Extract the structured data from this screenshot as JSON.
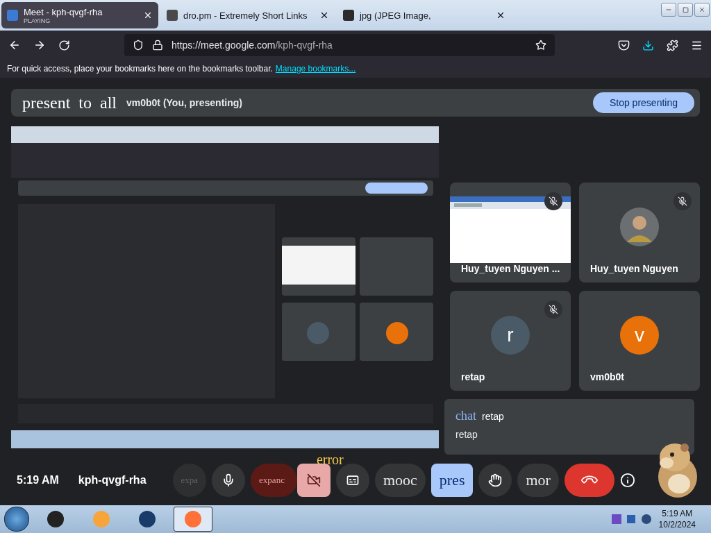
{
  "tabs": [
    {
      "title": "Meet - kph-qvgf-rha",
      "subtitle": "PLAYING",
      "selected": true
    },
    {
      "title": "dro.pm - Extremely Short Links",
      "selected": false
    },
    {
      "title": "jpg (JPEG Image, ",
      "selected": false
    }
  ],
  "address_bar": {
    "url_host": "https://meet.google.com",
    "url_path": "/kph-qvgf-rha"
  },
  "bookmarks_bar": {
    "message": "For quick access, place your bookmarks here on the bookmarks toolbar.",
    "link": "Manage bookmarks..."
  },
  "presenting_bar": {
    "title": "present to all",
    "presenter": "vm0b0t (You, presenting)",
    "button": "Stop presenting"
  },
  "participants": [
    {
      "name": "Huy_tuyen Nguyen ...",
      "kind": "screen",
      "muted": true
    },
    {
      "name": "Huy_tuyen Nguyen",
      "muted": true
    },
    {
      "name": "retap",
      "kind": "initial",
      "initial": "r",
      "color": "#4a5a66",
      "muted": true
    },
    {
      "name": "vm0b0t",
      "kind": "initial",
      "initial": "v",
      "color": "#e8710a",
      "muted": false
    }
  ],
  "chat": {
    "label": "chat",
    "sender": "retap",
    "message": "retap"
  },
  "meeting_info": {
    "time": "5:19 AM",
    "code": "kph-qvgf-rha"
  },
  "controls": [
    {
      "kind": "ghost",
      "label": "expa"
    },
    {
      "kind": "mic"
    },
    {
      "kind": "danger",
      "label": "expanc"
    },
    {
      "kind": "camera_off",
      "badge": "error"
    },
    {
      "kind": "captions"
    },
    {
      "kind": "pill",
      "label": "mooc"
    },
    {
      "kind": "active",
      "label": "pres"
    },
    {
      "kind": "hand"
    },
    {
      "kind": "pill",
      "label": "mor"
    },
    {
      "kind": "hangup"
    }
  ],
  "taskbar": {
    "apps": [
      {
        "selected": false
      },
      {
        "selected": false
      },
      {
        "selected": false
      },
      {
        "selected": true
      }
    ],
    "time": "5:19 AM",
    "date": "10/2/2024"
  }
}
